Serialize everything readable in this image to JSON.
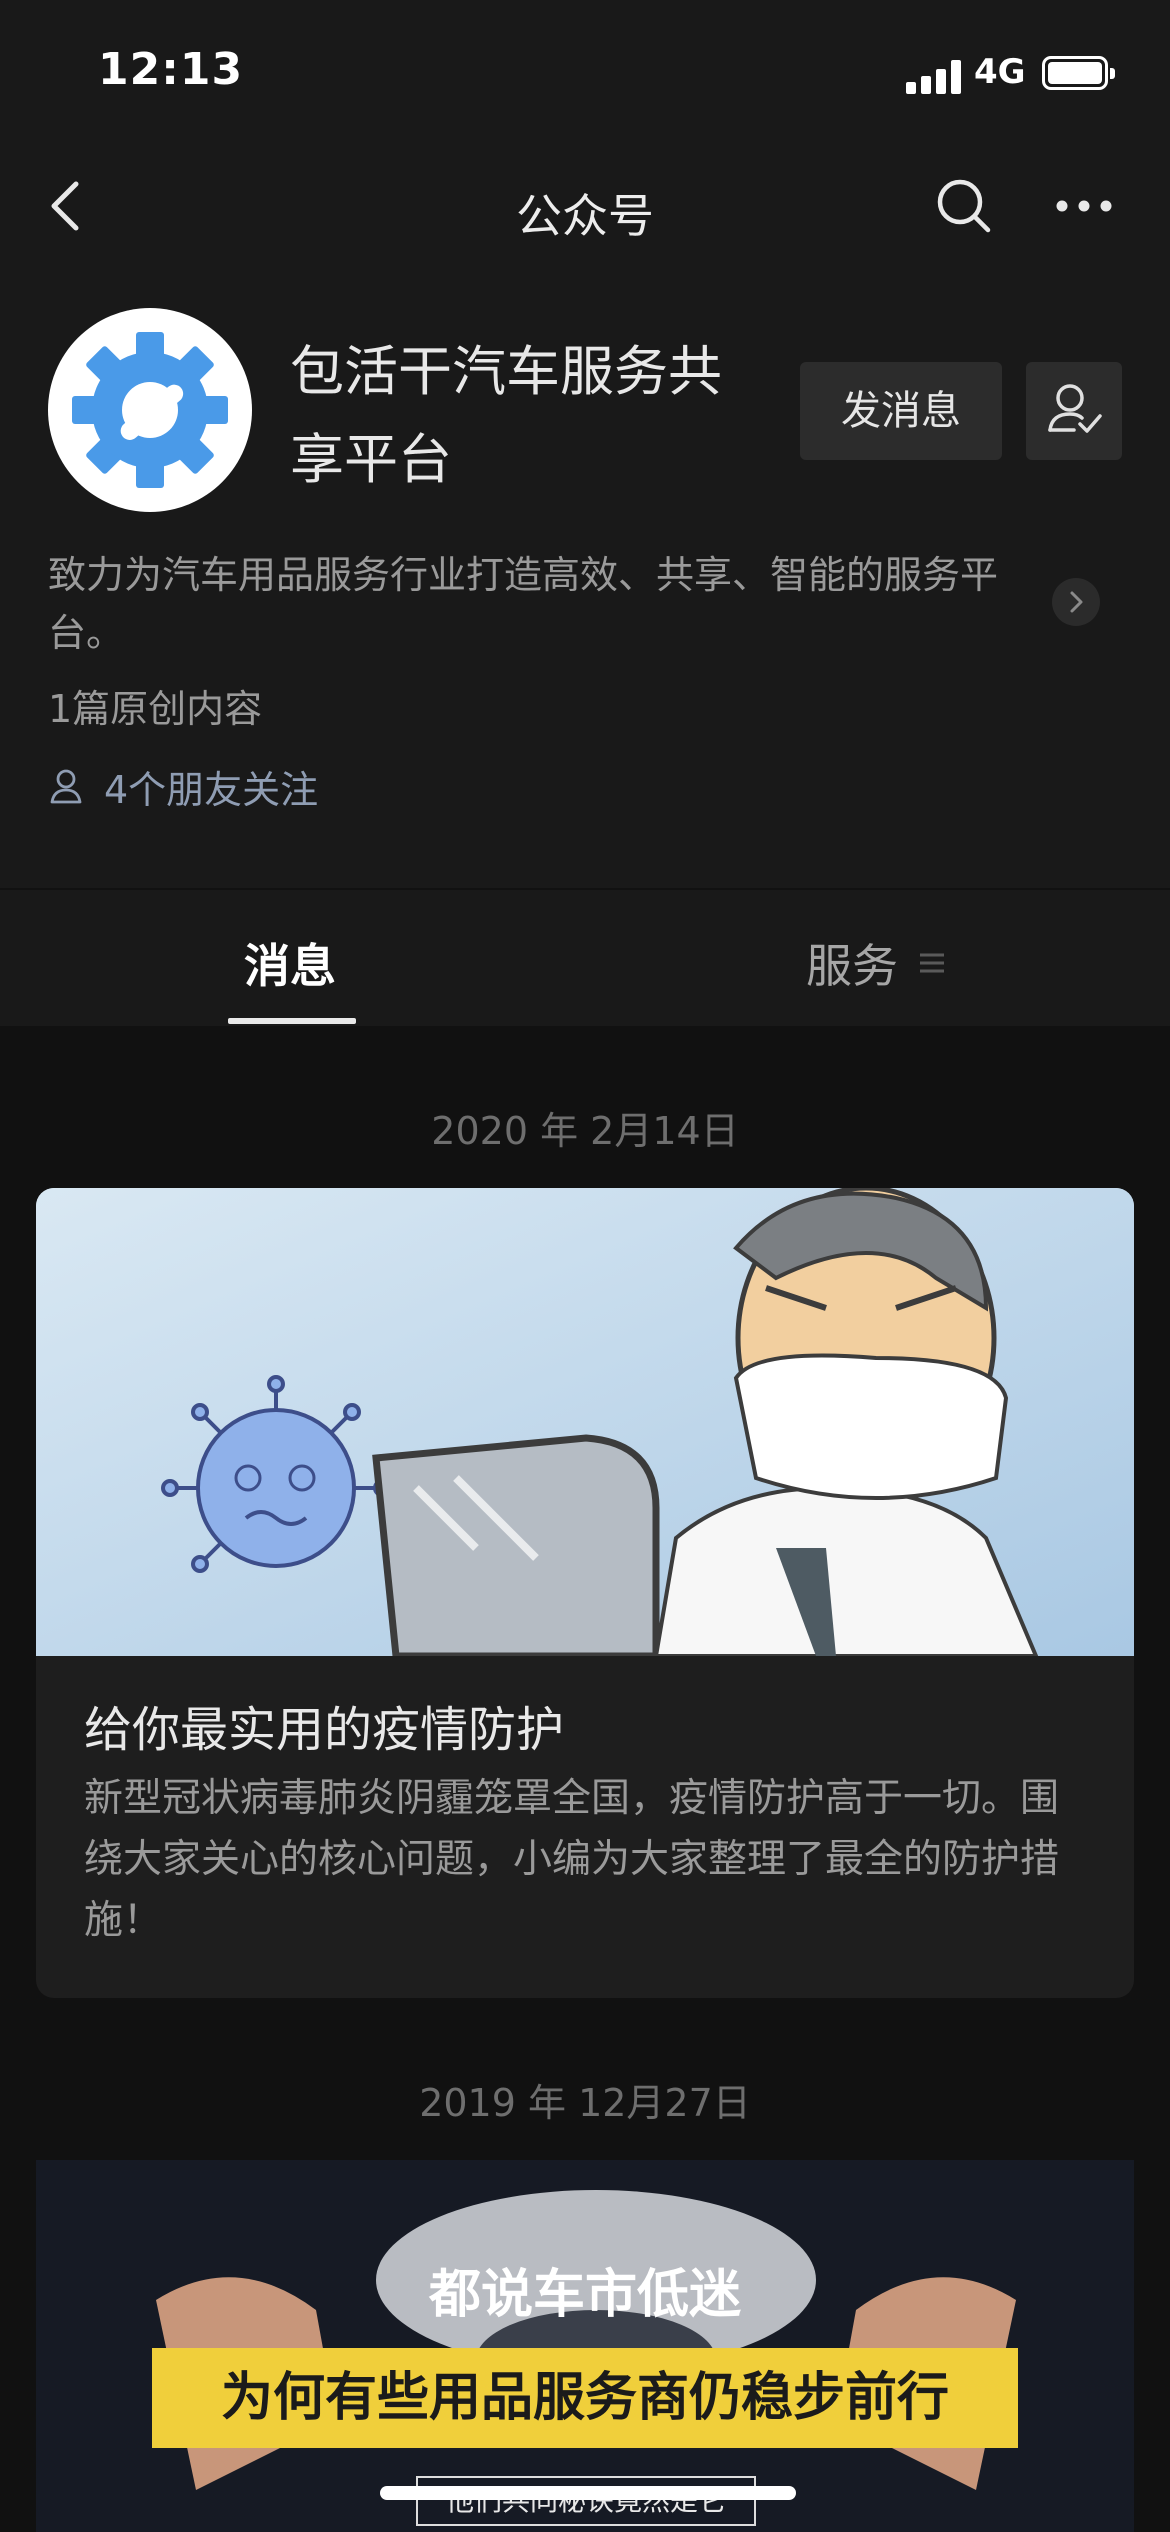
{
  "status_bar": {
    "time": "12:13",
    "network": "4G"
  },
  "nav": {
    "title": "公众号"
  },
  "account": {
    "name": "包活干汽车服务共享平台",
    "send_message_label": "发消息",
    "description": "致力为汽车用品服务行业打造高效、共享、智能的服务平台。",
    "original_count": "1篇原创内容",
    "friends_follow": "4个朋友关注"
  },
  "tabs": [
    {
      "label": "消息",
      "active": true
    },
    {
      "label": "服务",
      "active": false
    }
  ],
  "articles": [
    {
      "date": "2020 年 2月14日",
      "title": "给你最实用的疫情防护",
      "summary": "新型冠状病毒肺炎阴霾笼罩全国，疫情防护高于一切。围绕大家关心的核心问题，小编为大家整理了最全的防护措施！"
    },
    {
      "date": "2019 年 12月27日",
      "headline": "都说车市低迷",
      "subheadline": "为何有些用品服务商仍稳步前行",
      "caption": "他们共同秘诀竟然是它"
    }
  ],
  "colors": {
    "background": "#111111",
    "panel": "#191919",
    "logo_blue": "#4a9ae8",
    "poster_yellow": "#f0cf3b",
    "friends_link": "#8f9db3"
  },
  "icons": [
    "back-arrow-icon",
    "search-icon",
    "more-icon",
    "followed-user-icon",
    "chevron-right-icon",
    "friends-icon",
    "menu-icon"
  ]
}
